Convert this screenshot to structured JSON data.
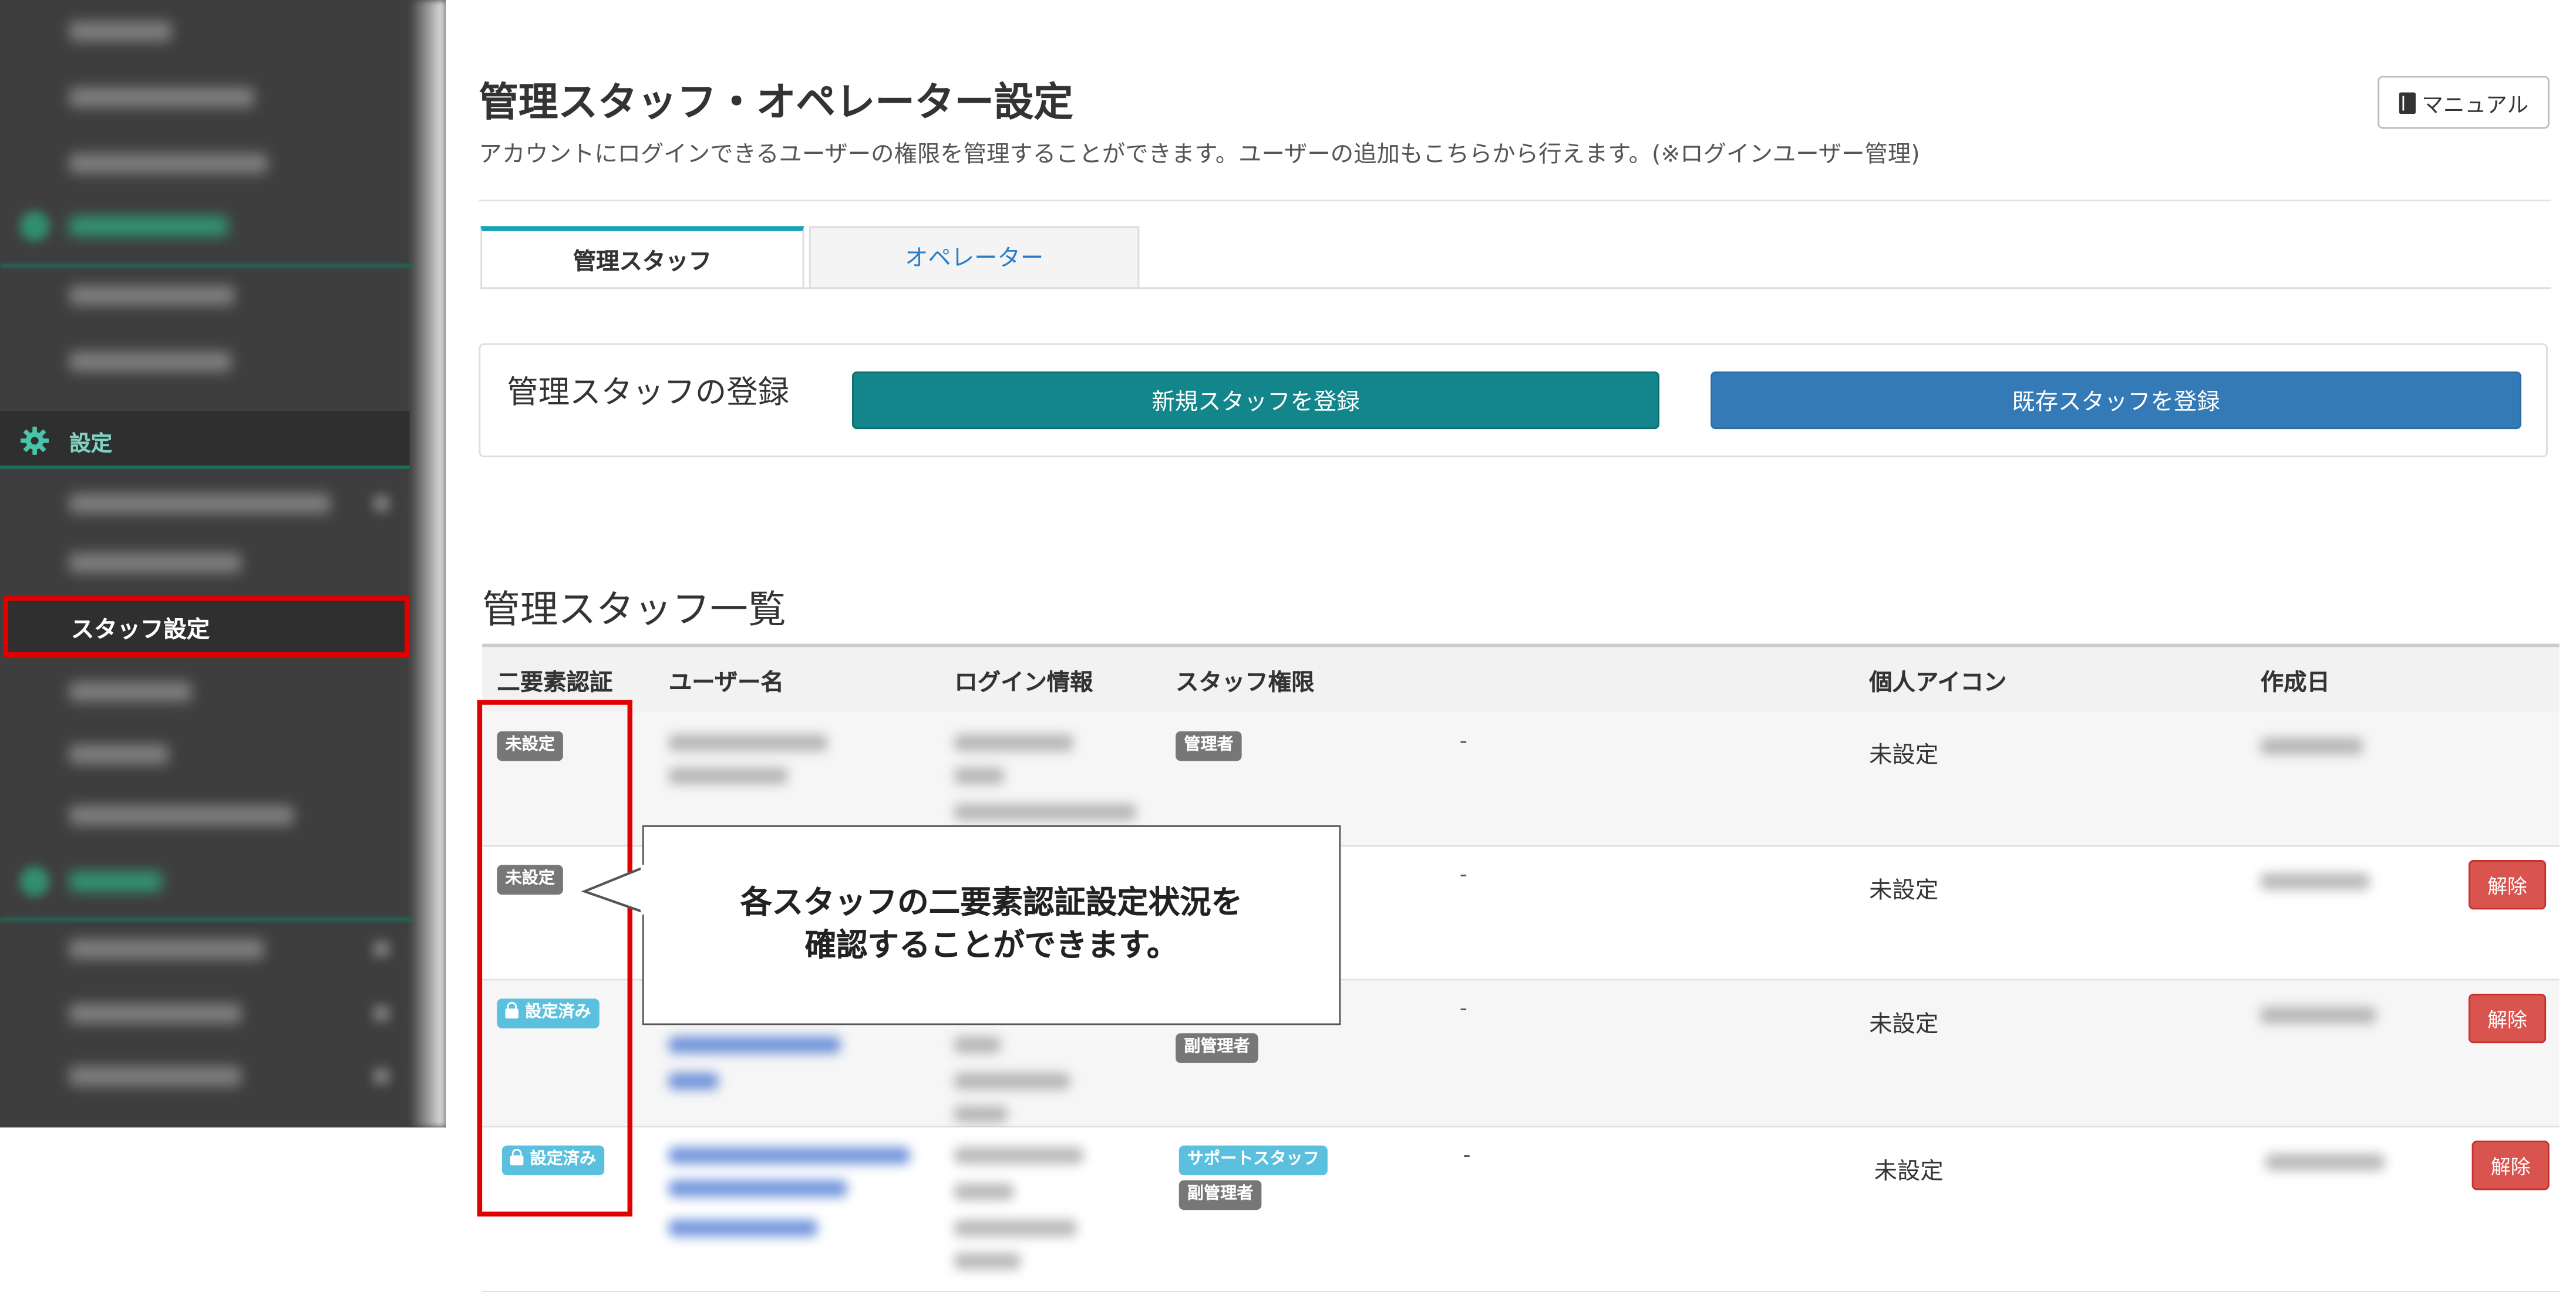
{
  "sidebar": {
    "settings_label": "設定",
    "staff_settings_label": "スタッフ設定"
  },
  "header": {
    "title": "管理スタッフ・オペレーター設定",
    "description": "アカウントにログインできるユーザーの権限を管理することができます。ユーザーの追加もこちらから行えます。(※ログインユーザー管理)",
    "manual_label": "マニュアル"
  },
  "tabs": [
    {
      "label": "管理スタッフ",
      "active": true
    },
    {
      "label": "オペレーター",
      "active": false
    }
  ],
  "register": {
    "title": "管理スタッフの登録",
    "new_button": "新規スタッフを登録",
    "existing_button": "既存スタッフを登録"
  },
  "list": {
    "title": "管理スタッフ一覧",
    "columns": [
      "二要素認証",
      "ユーザー名",
      "ログイン情報",
      "スタッフ権限",
      "個人アイコン",
      "作成日"
    ],
    "rows": [
      {
        "two_factor": "未設定",
        "roles": [
          "管理者"
        ],
        "extra": "-",
        "icon": "未設定",
        "delete": ""
      },
      {
        "two_factor": "未設定",
        "roles": [],
        "extra": "-",
        "icon": "未設定",
        "delete": "解除"
      },
      {
        "two_factor": "設定済み",
        "roles": [
          "副管理者"
        ],
        "extra": "-",
        "icon": "未設定",
        "delete": "解除"
      },
      {
        "two_factor": "設定済み",
        "roles": [
          "サポートスタッフ",
          "副管理者"
        ],
        "extra": "-",
        "icon": "未設定",
        "delete": "解除"
      }
    ]
  },
  "annotation": {
    "line1": "各スタッフの二要素認証設定状況を",
    "line2": "確認することができます。"
  },
  "colors": {
    "highlight_red": "#e00000",
    "teal_button": "#12868b",
    "blue_button": "#337ab7",
    "danger": "#d9534f",
    "badge_gray": "#777777",
    "badge_info": "#5bc0de",
    "tab_accent": "#17a2b8"
  }
}
